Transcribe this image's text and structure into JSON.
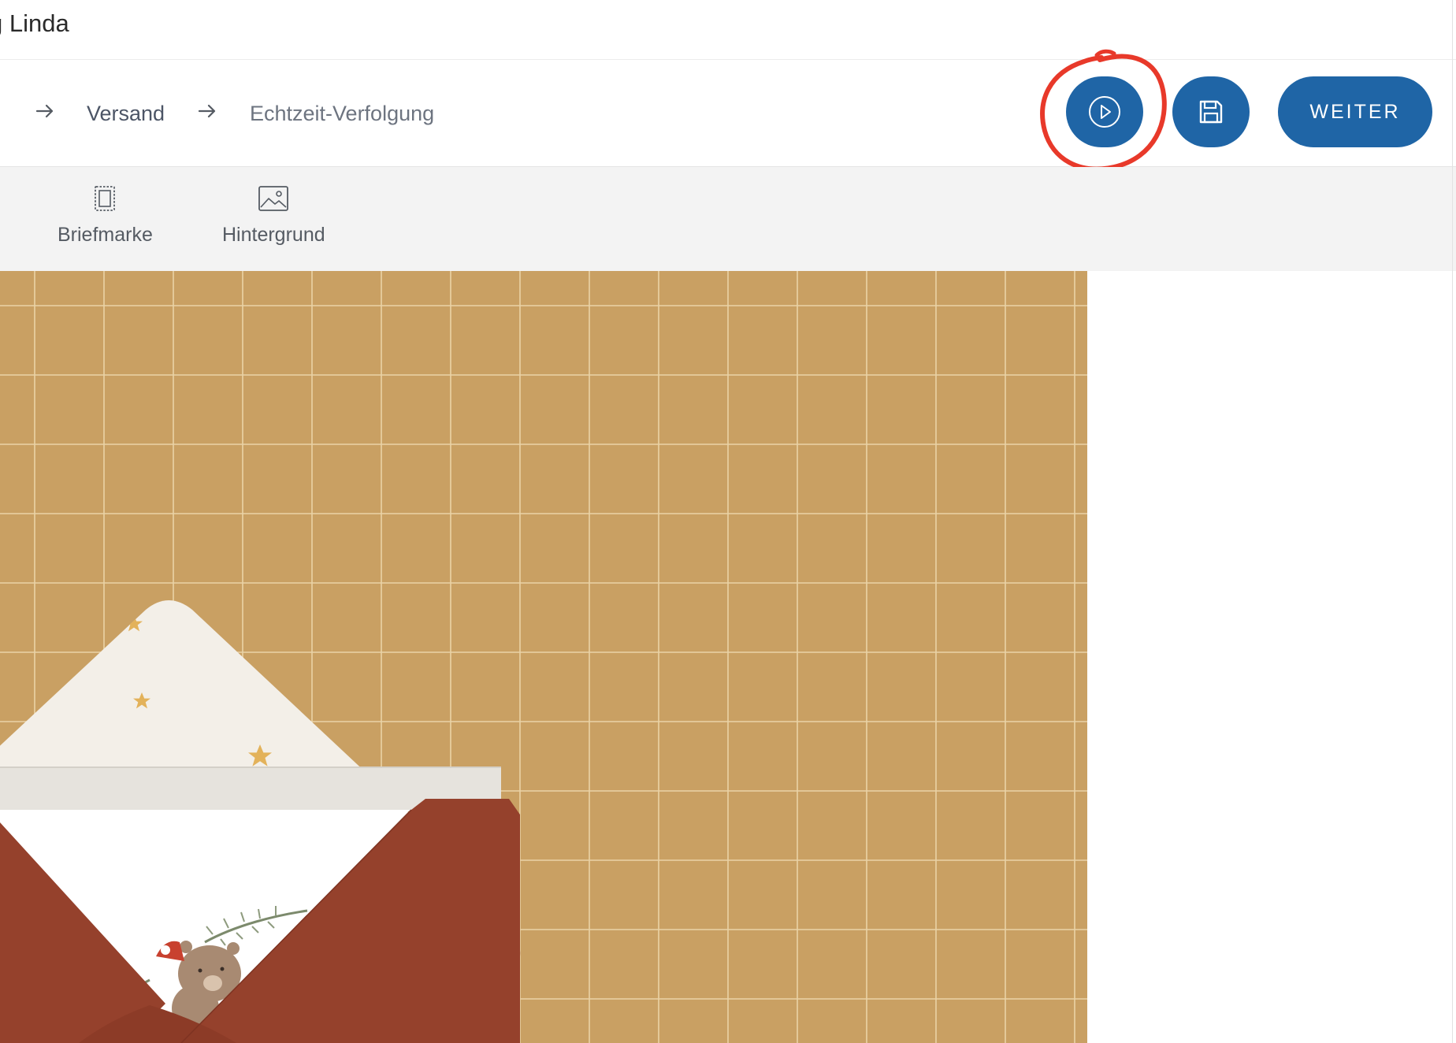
{
  "window": {
    "title": "g Linda"
  },
  "breadcrumb": {
    "items": [
      {
        "label": "Versand",
        "state": "active"
      },
      {
        "label": "Echtzeit-Verfolgung",
        "state": "inactive"
      }
    ]
  },
  "actions": {
    "preview_icon": "play-circle-icon",
    "save_icon": "floppy-disk-icon",
    "next_label": "WEITER"
  },
  "toolbar": {
    "items": [
      {
        "label": "Briefmarke",
        "icon": "stamp-icon"
      },
      {
        "label": "Hintergrund",
        "icon": "image-icon"
      }
    ]
  },
  "colors": {
    "primary_button": "#1f65a6",
    "annotation": "#e8392a",
    "background_tile": "#c9a063",
    "envelope": "#95412c",
    "liner": "#f3efe8",
    "star": "#e3b25a"
  }
}
